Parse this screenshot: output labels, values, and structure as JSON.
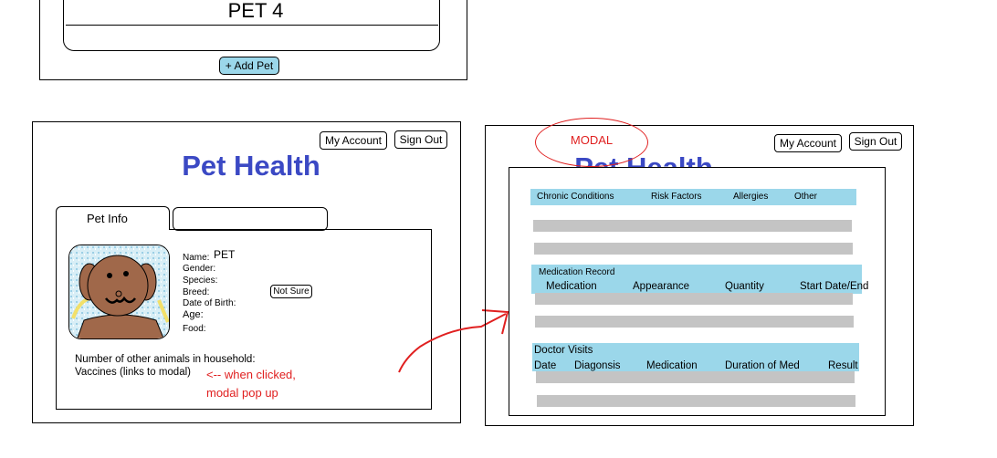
{
  "top_wireframe": {
    "pet_label": "PET 4",
    "add_pet_label": "+ Add Pet"
  },
  "left_panel": {
    "my_account_label": "My Account",
    "sign_out_label": "Sign Out",
    "title": "Pet Health",
    "tab_pet_info": "Pet Info",
    "fields": {
      "name_label": "Name:",
      "name_value": "PET",
      "gender_label": "Gender:",
      "species_label": "Species:",
      "breed_label": "Breed:",
      "dob_label": "Date of Birth:",
      "age_label": "Age:",
      "food_label": "Food:"
    },
    "not_sure_label": "Not Sure",
    "other_animals_text": "Number of other animals in household:",
    "vaccines_text": "Vaccines (links to modal)",
    "annotation_line1": "<-- when clicked,",
    "annotation_line2": "modal pop up"
  },
  "right_panel": {
    "modal_annotation": "MODAL",
    "my_account_label": "My Account",
    "sign_out_label": "Sign Out",
    "title": "Pet Health",
    "conditions_headers": [
      "Chronic Conditions",
      "Risk Factors",
      "Allergies",
      "Other"
    ],
    "medication_section_title": "Medication Record",
    "medication_headers": [
      "Medication",
      "Appearance",
      "Quantity",
      "Start Date/End"
    ],
    "doctor_section_title": "Doctor Visits",
    "doctor_headers": [
      "Date",
      "Diagonsis",
      "Medication",
      "Duration of Med",
      "Result"
    ]
  },
  "colors": {
    "title_blue": "#3b49c4",
    "header_bar": "#9bd7ea",
    "placeholder_row": "#c4c4c4",
    "annotation_red": "#e02020"
  }
}
